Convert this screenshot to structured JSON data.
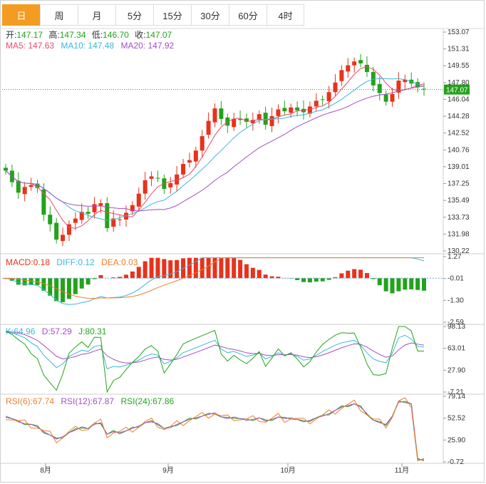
{
  "tabs": [
    "日",
    "周",
    "月",
    "5分",
    "15分",
    "30分",
    "60分",
    "4时"
  ],
  "active_tab": 0,
  "legend": {
    "open_label": "开:",
    "open": "147.17",
    "high_label": "高:",
    "high": "147.34",
    "low_label": "低:",
    "low": "146.70",
    "close_label": "收:",
    "close": "147.07",
    "ma5": "MA5: 147.63",
    "ma10": "MA10: 147.48",
    "ma20": "MA20: 147.92",
    "macd": "MACD:0.18",
    "diff": "DIFF:0.12",
    "dea": "DEA:0.03",
    "k": "K:64.96",
    "d": "D:57.29",
    "j": "J:80.31",
    "rsi6": "RSI(6):67.74",
    "rsi12": "RSI(12):67.87",
    "rsi24": "RSI(24):67.86"
  },
  "current_price": "147.07",
  "colors": {
    "up": "#e8321c",
    "down": "#22a31a",
    "ma5": "#e84a6b",
    "ma10": "#3bb7d9",
    "ma20": "#a24fc3",
    "dea": "#f07d2a",
    "macd_label": "#e8321c",
    "diff_label": "#3bb7d9",
    "dea_label": "#f07d2a",
    "k": "#3bb7d9",
    "d": "#a24fc3",
    "j": "#22a31a",
    "rsi6": "#f07d2a",
    "rsi12": "#a24fc3",
    "rsi24": "#22a31a",
    "active_tab": "#f39c21",
    "price_line": "#22a31a"
  },
  "chart_data": {
    "type": "candlestick",
    "x_ticks": [
      "8月",
      "9月",
      "10月",
      "11月"
    ],
    "price_axis": {
      "ticks": [
        "153.07",
        "151.31",
        "149.55",
        "147.80",
        "146.04",
        "144.28",
        "142.52",
        "140.76",
        "139.01",
        "137.25",
        "135.49",
        "133.73",
        "131.98",
        "130.22"
      ],
      "range": [
        130.22,
        153.07
      ]
    },
    "macd_axis": {
      "ticks": [
        "1.27",
        "-0.01",
        "-1.30",
        "-2.59"
      ],
      "range": [
        -2.59,
        1.27
      ]
    },
    "kdj_axis": {
      "ticks": [
        "98.13",
        "63.01",
        "27.90",
        "-7.21"
      ],
      "range": [
        -7.21,
        98.13
      ]
    },
    "rsi_axis": {
      "ticks": [
        "79.14",
        "52.52",
        "25.90",
        "-0.72"
      ],
      "range": [
        -0.72,
        79.14
      ]
    },
    "closes": [
      138.6,
      137.4,
      136.3,
      136.9,
      137.1,
      136.8,
      134.0,
      133.0,
      131.4,
      131.9,
      133.0,
      133.6,
      134.3,
      134.1,
      135.1,
      135.2,
      132.6,
      133.6,
      133.5,
      134.2,
      135.0,
      136.2,
      137.6,
      138.0,
      137.8,
      136.7,
      137.3,
      138.2,
      139.3,
      139.7,
      140.7,
      142.2,
      143.8,
      145.1,
      144.0,
      143.3,
      144.0,
      143.9,
      143.7,
      143.9,
      144.5,
      143.4,
      144.3,
      145.0,
      144.8,
      145.2,
      144.9,
      144.7,
      145.3,
      145.9,
      146.0,
      146.8,
      147.8,
      149.1,
      149.6,
      150.0,
      149.8,
      148.9,
      147.5,
      146.7,
      145.8,
      146.6,
      148.0,
      148.1,
      147.7,
      147.3,
      147.07
    ],
    "rsi12": [
      55,
      52,
      48,
      46,
      45,
      42,
      36,
      32,
      27,
      30,
      35,
      38,
      42,
      40,
      45,
      47,
      33,
      36,
      35,
      37,
      40,
      43,
      47,
      48,
      46,
      40,
      41,
      45,
      48,
      51,
      53,
      55,
      57,
      59,
      54,
      52,
      54,
      52,
      50,
      51,
      53,
      49,
      51,
      54,
      52,
      53,
      51,
      48,
      50,
      53,
      55,
      58,
      62,
      66,
      68,
      70,
      66,
      58,
      50,
      47,
      45,
      55,
      72,
      73,
      70,
      2,
      2
    ],
    "k_values": [
      90,
      88,
      84,
      80,
      72,
      66,
      52,
      42,
      32,
      38,
      50,
      55,
      60,
      58,
      66,
      68,
      30,
      34,
      33,
      36,
      40,
      44,
      50,
      54,
      52,
      38,
      42,
      48,
      56,
      60,
      64,
      68,
      72,
      76,
      62,
      56,
      58,
      54,
      50,
      52,
      56,
      46,
      50,
      56,
      52,
      54,
      50,
      44,
      46,
      52,
      58,
      63,
      68,
      72,
      74,
      76,
      68,
      56,
      46,
      42,
      40,
      55,
      80,
      84,
      78,
      66,
      64.96
    ]
  }
}
